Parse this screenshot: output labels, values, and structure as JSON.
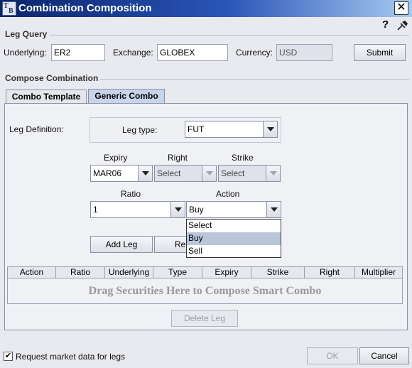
{
  "window": {
    "title": "Combination Composition",
    "logo_text_1": "T",
    "logo_text_2": "B",
    "close_glyph": "✕",
    "help_glyph": "?"
  },
  "leg_query": {
    "title": "Leg Query",
    "underlying_label": "Underlying:",
    "underlying_value": "ER2",
    "exchange_label": "Exchange:",
    "exchange_value": "GLOBEX",
    "currency_label": "Currency:",
    "currency_value": "USD",
    "submit_label": "Submit"
  },
  "compose": {
    "title": "Compose Combination",
    "tabs": [
      {
        "label": "Combo Template",
        "active": false
      },
      {
        "label": "Generic Combo",
        "active": true
      }
    ],
    "leg_definition_label": "Leg Definition:",
    "leg_type_label": "Leg type:",
    "leg_type_value": "FUT",
    "expiry_label": "Expiry",
    "expiry_value": "MAR06",
    "right_label": "Right",
    "right_value": "Select",
    "strike_label": "Strike",
    "strike_value": "Select",
    "ratio_label": "Ratio",
    "ratio_value": "1",
    "action_label": "Action",
    "action_value": "Buy",
    "action_options": [
      {
        "label": "Select",
        "selected": false
      },
      {
        "label": "Buy",
        "selected": true
      },
      {
        "label": "Sell",
        "selected": false
      }
    ],
    "add_leg_label": "Add Leg",
    "remove_label_visible": "Re",
    "table_columns": [
      "Action",
      "Ratio",
      "Underlying",
      "Type",
      "Expiry",
      "Strike",
      "Right",
      "Multiplier"
    ],
    "drop_hint": "Drag Securities Here to Compose Smart Combo",
    "delete_leg_label": "Delete Leg"
  },
  "footer": {
    "request_market_data_label": "Request market data for legs",
    "request_market_data_checked": true,
    "check_glyph": "✔",
    "ok_label": "OK",
    "cancel_label": "Cancel"
  }
}
